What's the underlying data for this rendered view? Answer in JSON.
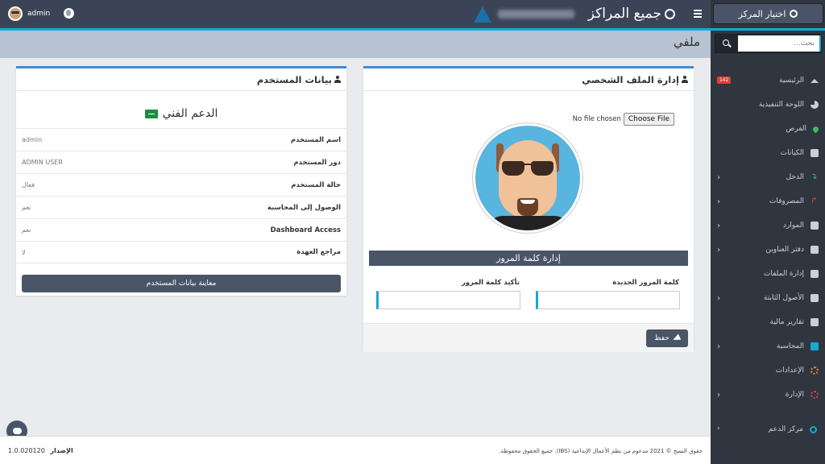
{
  "header": {
    "user_name": "admin",
    "title": "جميع المراكز"
  },
  "page_title": "ملفي",
  "sidebar": {
    "select_center_label": "اختيار المركز",
    "search_placeholder": "بحث...",
    "items": [
      {
        "label": "الرئيسية",
        "icon": "home-icon",
        "badge": "142",
        "has_chevron": false
      },
      {
        "label": "اللوحة التنفيذية",
        "icon": "pie-chart-icon",
        "has_chevron": false
      },
      {
        "label": "الفرص",
        "icon": "map-pin-icon",
        "has_chevron": false
      },
      {
        "label": "الكيانات",
        "icon": "bank-icon",
        "has_chevron": false
      },
      {
        "label": "الدخل",
        "icon": "income-arrow-icon",
        "has_chevron": true
      },
      {
        "label": "المصروفات",
        "icon": "expense-arrow-icon",
        "has_chevron": true
      },
      {
        "label": "الموارد",
        "icon": "users-icon",
        "has_chevron": true
      },
      {
        "label": "دفتر العناوين",
        "icon": "address-book-icon",
        "has_chevron": true
      },
      {
        "label": "إدارة الملفات",
        "icon": "files-icon",
        "has_chevron": false
      },
      {
        "label": "الأصول الثابتة",
        "icon": "cubes-icon",
        "has_chevron": true
      },
      {
        "label": "تقارير مالية",
        "icon": "bar-chart-icon",
        "has_chevron": false
      },
      {
        "label": "المحاسبة",
        "icon": "calculator-icon",
        "has_chevron": true
      },
      {
        "label": "الإعدادات",
        "icon": "cogs-icon",
        "has_chevron": false
      },
      {
        "label": "الإدارة",
        "icon": "admin-cogs-icon",
        "has_chevron": true
      }
    ],
    "support_label": "مركز الدعم"
  },
  "profile_panel": {
    "title": "إدارة الملف الشخصي",
    "no_file_text": "No file chosen",
    "choose_file_label": "Choose File",
    "password_section_title": "إدارة كلمة المرور",
    "new_password_label": "كلمة المرور الجديدة",
    "confirm_password_label": "تأكيد كلمة المرور",
    "save_label": "حفظ"
  },
  "user_panel": {
    "title": "بيانات المستخدم",
    "support_title": "الدعم الفني",
    "rows": [
      {
        "key": "اسم المستخدم",
        "value": "admin"
      },
      {
        "key": "دور المستخدم",
        "value": "ADMIN USER"
      },
      {
        "key": "حالة المستخدم",
        "value": "فعال"
      },
      {
        "key": "الوصول إلى المحاسبة",
        "value": "نعم"
      },
      {
        "key": "Dashboard Access",
        "value": "نعم"
      },
      {
        "key": "مراجع العهدة",
        "value": "لا"
      }
    ],
    "view_button_label": "معاينة بيانات المستخدم"
  },
  "footer": {
    "copyright": "حقوق النسخ © 2021 مدعوم من نظم الأعمال الإبداعية (IBS). جميع الحقوق محفوظة.",
    "version_label": "الإصدار",
    "version": "1.0.020120"
  }
}
